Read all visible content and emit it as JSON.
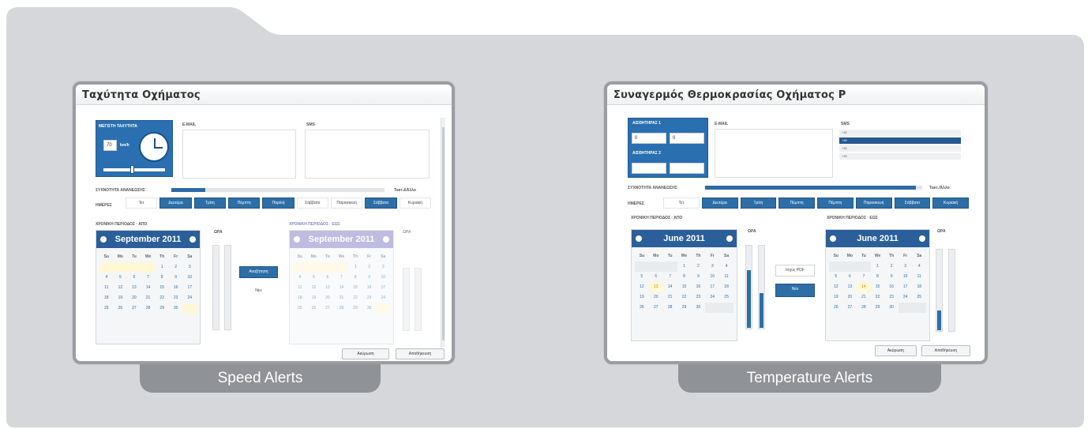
{
  "captions": {
    "left": "Speed Alerts",
    "right": "Temperature Alerts"
  },
  "colors": {
    "accent": "#2d6ea7",
    "folder": "#d5d7da",
    "caption_tab": "#8f9296"
  },
  "speed_dialog": {
    "title": "Ταχύτητα Οχήματος",
    "panel_label": "ΜΕΓΙΣΤΗ ΤΑΧΥΤΗΤΑ",
    "panel_value": "70",
    "panel_unit": "km/h",
    "email_label": "E-MAIL",
    "sms_label": "SMS",
    "freq_label": "ΣΥΧΝΟΤΗΤΑ ΑΝΑΝΕΩΣΗΣ",
    "freq_right": "Τακτ.&Άλλο",
    "freq_fraction": 0.16,
    "days_label": "ΗΜΕΡΕΣ",
    "days": [
      "Τετ",
      "Δευτέρα",
      "Τρίτη",
      "Πέμπτη",
      "Παρ/κή",
      "Σάββατο",
      "Παρασκευή",
      "Σάββατο",
      "Κυριακή"
    ],
    "period_start_label": "ΧΡΟΝΙΚΗ ΠΕΡΙΟΔΟΣ · ΑΠΟ",
    "period_end_label": "ΧΡΟΝΙΚΗ ΠΕΡΙΟΔΟΣ · ΕΩΣ",
    "cal_left_month": "September 2011",
    "cal_right_month": "September 2011",
    "time_label_left": "ΩΡΑ",
    "time_label_right": "ΩΡΑ",
    "middle_button": "Αναζήτηση",
    "middle_sub": "Νέο",
    "save_button": "Αποθήκευση",
    "cancel_button": "Ακύρωση"
  },
  "temp_dialog": {
    "title": "Συναγερμός Θερμοκρασίας Οχήματος P",
    "sensor1_label": "ΑΙΣΘΗΤΗΡΑΣ 1",
    "sensor2_label": "ΑΙΣΘΗΤΗΡΑΣ 2",
    "sensor1_min": "0",
    "sensor1_max": "0",
    "email_label": "E-MAIL",
    "sms_label": "SMS",
    "sms_options": [
      "+30",
      "+30",
      "+30",
      "+30"
    ],
    "freq_label": "ΣΥΧΝΟΤΗΤΑ ΑΝΑΝΕΩΣΗΣ",
    "freq_right": "Τακτ./Άλλο",
    "freq_fraction": 0.97,
    "days_label": "ΗΜΕΡΕΣ",
    "days": [
      "Τετ",
      "Δευτέρα",
      "Τρίτη",
      "Πέμπτη",
      "Πέμπτη",
      "Παρασκευή",
      "Σάββατο",
      "Κυριακή"
    ],
    "period_start_label": "ΧΡΟΝΙΚΗ ΠΕΡΙΟΔΟΣ · ΑΠΟ",
    "period_end_label": "ΧΡΟΝΙΚΗ ΠΕΡΙΟΔΟΣ · ΕΩΣ",
    "cal_left_month": "June 2011",
    "cal_right_month": "June 2011",
    "time_label_left": "ΩΡΑ",
    "time_label_right": "ΩΡΑ",
    "middle_button": "Ισχύς PDF",
    "middle_sub": "Νέο",
    "save_button": "Αποθήκευση",
    "cancel_button": "Ακύρωση"
  },
  "weekdays": [
    "Su",
    "Mo",
    "Tu",
    "We",
    "Th",
    "Fr",
    "Sa"
  ],
  "sept_days": [
    "",
    "",
    "",
    "",
    "1",
    "2",
    "3",
    "4",
    "5",
    "6",
    "7",
    "8",
    "9",
    "10",
    "11",
    "12",
    "13",
    "14",
    "15",
    "16",
    "17",
    "18",
    "19",
    "20",
    "21",
    "22",
    "23",
    "24",
    "25",
    "26",
    "27",
    "28",
    "29",
    "30",
    ""
  ],
  "june_days": [
    "",
    "",
    "",
    "1",
    "2",
    "3",
    "4",
    "5",
    "6",
    "7",
    "8",
    "9",
    "10",
    "11",
    "12",
    "13",
    "14",
    "15",
    "16",
    "17",
    "18",
    "19",
    "20",
    "21",
    "22",
    "23",
    "24",
    "25",
    "26",
    "27",
    "28",
    "29",
    "30",
    "",
    ""
  ]
}
